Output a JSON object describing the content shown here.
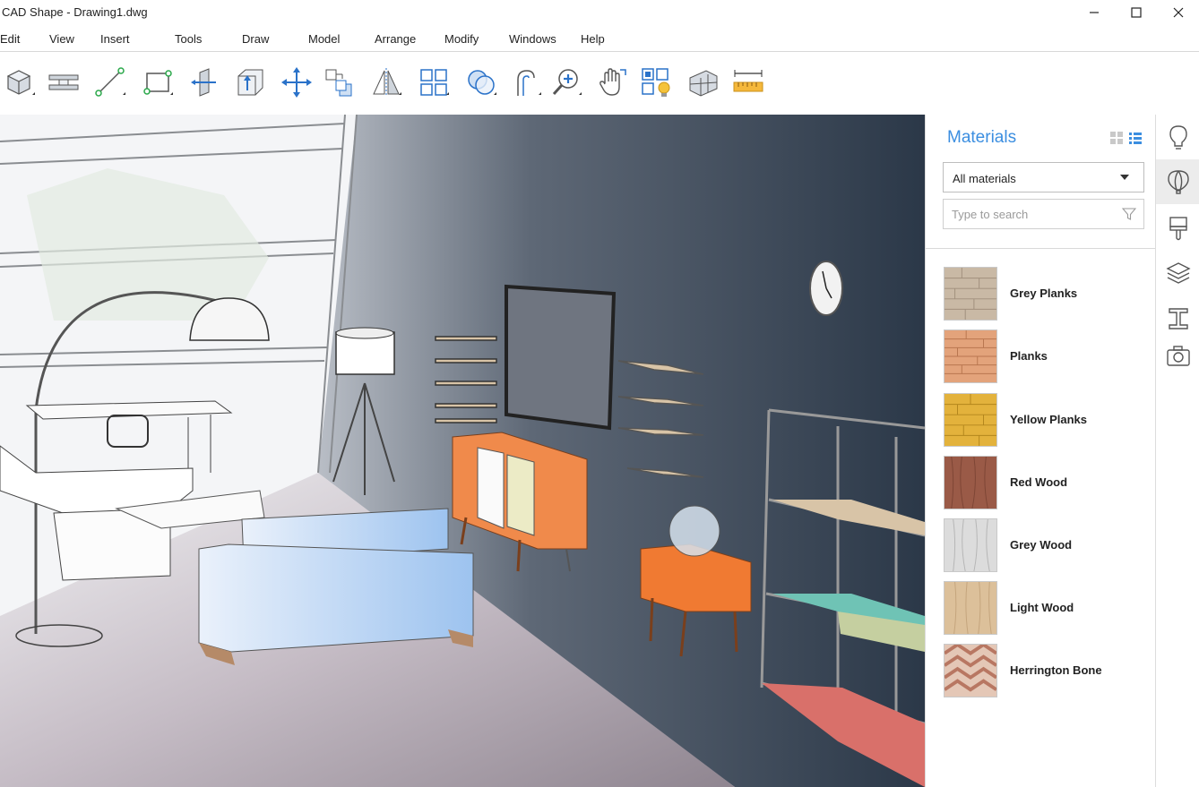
{
  "window": {
    "title": "CAD Shape - Drawing1.dwg"
  },
  "menu": [
    "Edit",
    "View",
    "Insert",
    "Tools",
    "Draw",
    "Model",
    "Arrange",
    "Modify",
    "Windows",
    "Help"
  ],
  "toolbar": {
    "tools": [
      "box-icon",
      "beam-icon",
      "line-icon",
      "rectangle-icon",
      "extrude-icon",
      "push-pull-icon",
      "move-icon",
      "copy-icon",
      "mirror-icon",
      "array-icon",
      "boolean-icon",
      "fillet-icon",
      "zoom-icon",
      "pan-hand-icon",
      "render-light-icon",
      "wall-icon",
      "measure-icon"
    ]
  },
  "materials_panel": {
    "title": "Materials",
    "filter_selected": "All materials",
    "search_placeholder": "Type to search",
    "items": [
      {
        "name": "Grey Planks",
        "color": "#c9b9a5"
      },
      {
        "name": "Planks",
        "color": "#e3a37b"
      },
      {
        "name": "Yellow Planks",
        "color": "#e3b23c"
      },
      {
        "name": "Red Wood",
        "color": "#9a5a47"
      },
      {
        "name": "Grey Wood",
        "color": "#d9d9d9"
      },
      {
        "name": "Light Wood",
        "color": "#dcc09a"
      },
      {
        "name": "Herrington Bone",
        "color": "#c98f7a"
      }
    ]
  },
  "side_rail": {
    "buttons": [
      "lightbulb-icon",
      "balloon-icon",
      "paint-brush-icon",
      "layers-icon",
      "i-beam-icon",
      "camera-icon"
    ],
    "active_index": 1
  },
  "colors": {
    "accent": "#3b8ee0",
    "wall": "#2f3c4d",
    "floor": "#b6a9b3"
  }
}
